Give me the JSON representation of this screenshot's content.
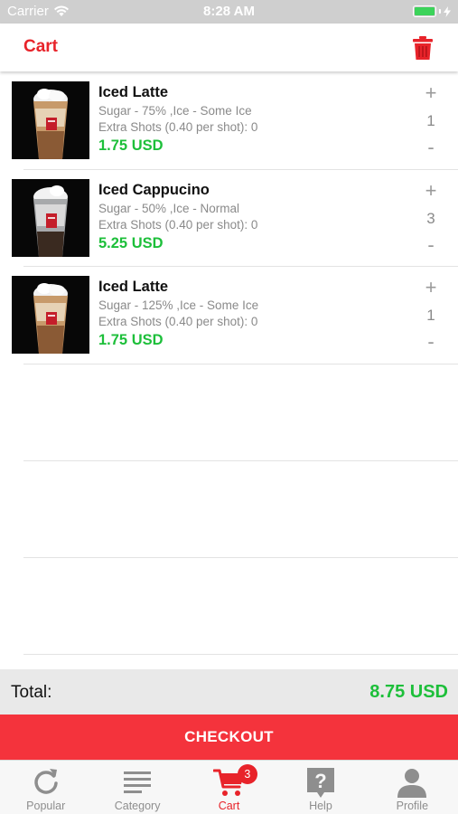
{
  "status_bar": {
    "carrier": "Carrier",
    "time": "8:28 AM"
  },
  "nav": {
    "title": "Cart"
  },
  "cart_items": [
    {
      "name": "Iced Latte",
      "options": "Sugar - 75% ,Ice - Some Ice",
      "extra": "Extra Shots (0.40 per shot): 0",
      "price": "1.75 USD",
      "quantity": "1",
      "plus": "+",
      "minus": "-"
    },
    {
      "name": "Iced Cappucino",
      "options": "Sugar - 50% ,Ice - Normal",
      "extra": "Extra Shots (0.40 per shot): 0",
      "price": "5.25 USD",
      "quantity": "3",
      "plus": "+",
      "minus": "-"
    },
    {
      "name": "Iced Latte",
      "options": "Sugar - 125% ,Ice - Some Ice",
      "extra": "Extra Shots (0.40 per shot): 0",
      "price": "1.75 USD",
      "quantity": "1",
      "plus": "+",
      "minus": "-"
    }
  ],
  "total": {
    "label": "Total:",
    "value": "8.75 USD"
  },
  "checkout": {
    "label": "CHECKOUT"
  },
  "tabs": [
    {
      "label": "Popular",
      "icon": "refresh-icon"
    },
    {
      "label": "Category",
      "icon": "list-icon"
    },
    {
      "label": "Cart",
      "icon": "cart-icon",
      "badge": "3",
      "active": true
    },
    {
      "label": "Help",
      "icon": "help-icon"
    },
    {
      "label": "Profile",
      "icon": "profile-icon"
    }
  ],
  "colors": {
    "accent_red": "#e8232a",
    "checkout_red": "#f4333c",
    "price_green": "#1dbf3a",
    "status_bar": "#cfcfcf"
  }
}
